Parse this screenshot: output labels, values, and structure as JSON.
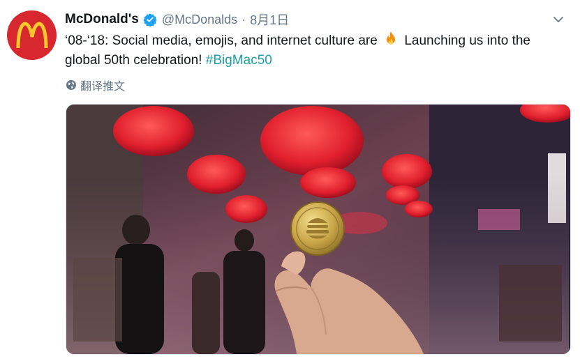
{
  "tweet": {
    "display_name": "McDonald's",
    "handle": "@McDonalds",
    "separator": "·",
    "timestamp": "8月1日",
    "text_before_emoji": "‘08-‘18: Social media, emojis, and internet culture are",
    "text_after_emoji": "Launching us into the global 50th celebration!",
    "hashtag": "#BigMac50",
    "translate_label": "翻译推文"
  },
  "icons": {
    "avatar": "mcdonalds-arches-logo",
    "verified": "verified-badge-icon",
    "menu": "chevron-down-icon",
    "emoji": "fire-emoji-icon",
    "translate": "globe-icon"
  },
  "colors": {
    "avatar_bg": "#d7282f",
    "arches": "#ffc72c",
    "verified": "#1da1f2",
    "hashtag": "#1da1a5",
    "muted": "#657786"
  }
}
